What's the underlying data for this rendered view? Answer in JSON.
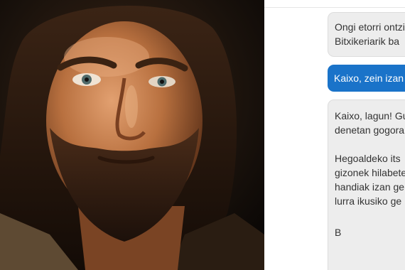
{
  "messages": [
    {
      "role": "bot",
      "lines": [
        "Ongi etorri ontzi",
        "Bitxikeriarik ba"
      ]
    },
    {
      "role": "user",
      "text": "Kaixo, zein izan"
    },
    {
      "role": "bot",
      "paragraphs": [
        [
          "Kaixo, lagun! Gu",
          "denetan gogora"
        ],
        [
          "Hegoaldeko its",
          "gizonek hilabete",
          "handiak izan ge",
          "lurra ikusiko ge"
        ],
        [
          "B"
        ]
      ]
    }
  ],
  "colors": {
    "user_bubble": "#1a73c9",
    "bot_bubble": "#ededed"
  }
}
